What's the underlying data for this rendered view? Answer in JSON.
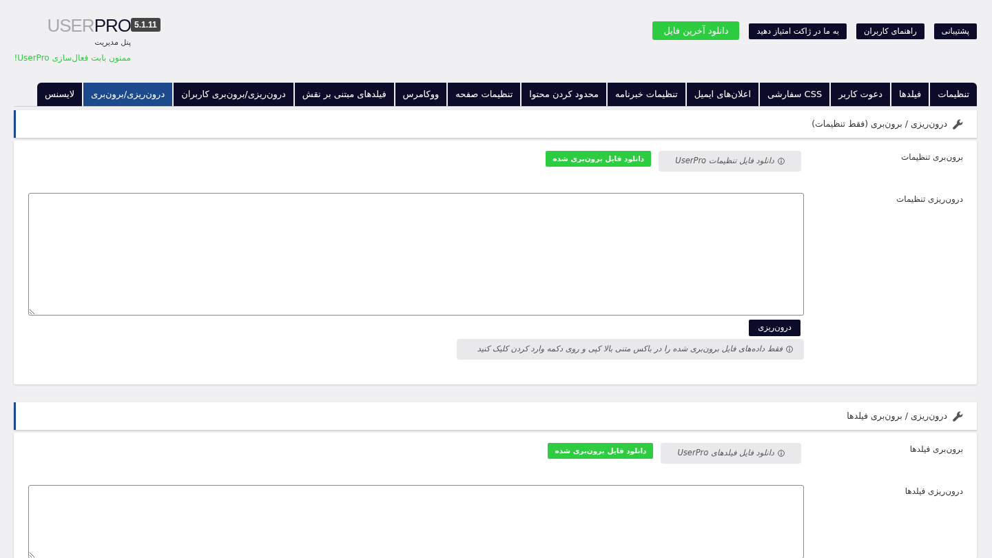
{
  "header": {
    "logo": {
      "prefix": "USER",
      "suffix": "PRO",
      "version": "5.1.11"
    },
    "subtitle": "پنل مدیریت",
    "notice": "ممنون بابت فعال‌سازی UserPro!"
  },
  "top_buttons": [
    {
      "label": "پشتیبانی",
      "kind": "dark"
    },
    {
      "label": "راهنمای کاربران",
      "kind": "dark"
    },
    {
      "label": "به ما در ژاکت امتیاز دهید",
      "kind": "dark"
    },
    {
      "label": "دانلود آخرین فایل",
      "kind": "green"
    }
  ],
  "tabs": [
    {
      "label": "تنظیمات",
      "selected": false
    },
    {
      "label": "فیلدها",
      "selected": false
    },
    {
      "label": "دعوت کاربر",
      "selected": false
    },
    {
      "label": "CSS سفارشی",
      "selected": false
    },
    {
      "label": "اعلان‌های ایمیل",
      "selected": false
    },
    {
      "label": "تنظیمات خبرنامه",
      "selected": false
    },
    {
      "label": "محدود کردن محتوا",
      "selected": false
    },
    {
      "label": "تنظیمات صفحه",
      "selected": false
    },
    {
      "label": "ووکامرس",
      "selected": false
    },
    {
      "label": "فیلدهای مبتنی بر نقش",
      "selected": false
    },
    {
      "label": "درون‌ریزی/برون‌بری کاربران",
      "selected": false
    },
    {
      "label": "درون‌ریزی/برون‌بری",
      "selected": true
    },
    {
      "label": "لایسنس",
      "selected": false
    }
  ],
  "sections": [
    {
      "title": "درون‌ریزی / برون‌بری (فقط تنظیمات)",
      "rows": [
        {
          "kind": "export",
          "label": "برون‌بری تنظیمات",
          "info": "دانلود فایل تنظیمات UserPro",
          "button": "دانلود فایل برون‌بری شده"
        },
        {
          "kind": "import",
          "label": "درون‌ریزی تنظیمات",
          "button": "درون‌ریزی",
          "info": "فقط داده‌های فایل برون‌بری شده را در باکس متنی بالا کپی و روی دکمه وارد کردن کلیک کنید"
        }
      ]
    },
    {
      "title": "درون‌ریزی / برون‌بری فیلدها",
      "rows": [
        {
          "kind": "export",
          "label": "برون‌بری فیلدها",
          "info": "دانلود فایل فیلدهای UserPro",
          "button": "دانلود فایل برون‌بری شده"
        },
        {
          "kind": "import",
          "label": "درون‌ریزی فیلدها"
        }
      ]
    }
  ]
}
